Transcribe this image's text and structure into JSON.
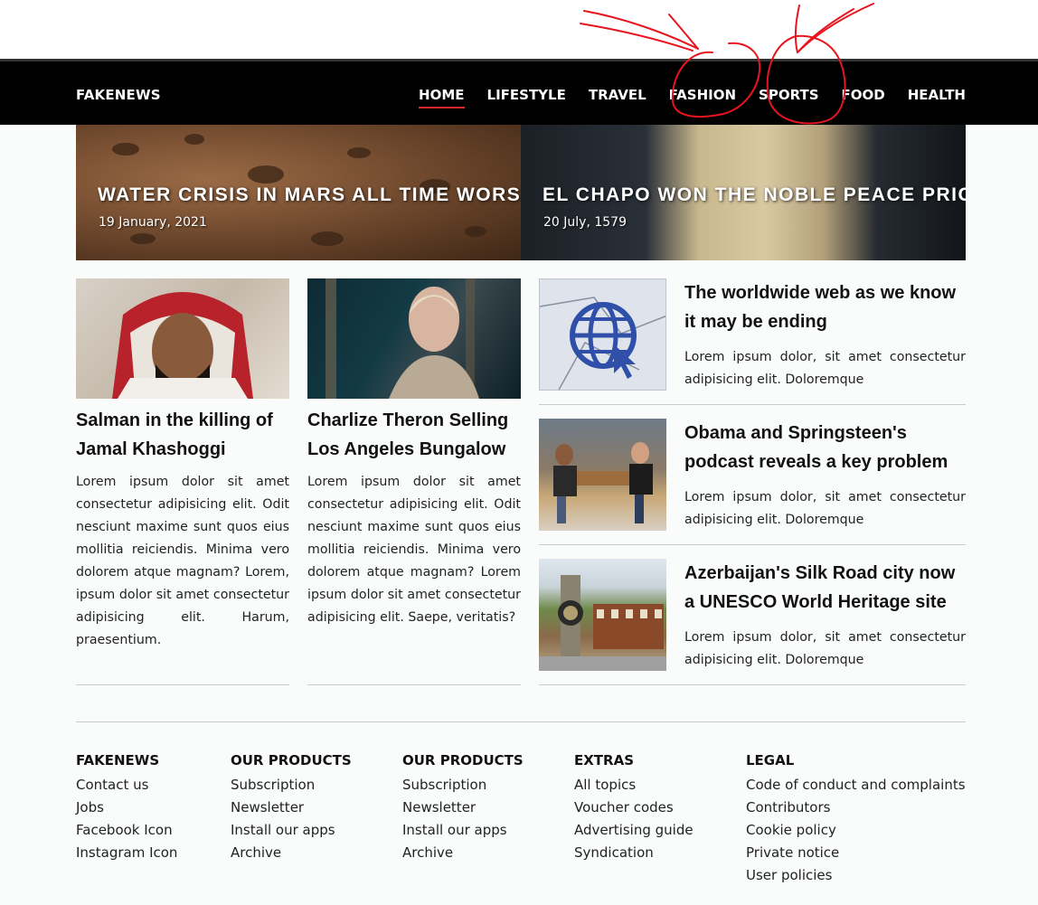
{
  "nav": {
    "brand": "FAKENEWS",
    "items": [
      {
        "label": "HOME",
        "active": true
      },
      {
        "label": "LIFESTYLE"
      },
      {
        "label": "TRAVEL"
      },
      {
        "label": "FASHION"
      },
      {
        "label": "SPORTS"
      },
      {
        "label": "FOOD"
      },
      {
        "label": "HEALTH"
      }
    ],
    "active_color": "#e0262d"
  },
  "annotation_color": "#e8141e",
  "hero": [
    {
      "title": "WATER CRISIS IN MARS ALL TIME WORST",
      "date": "19 January, 2021"
    },
    {
      "title": "EL CHAPO WON THE NOBLE PEACE PRICE",
      "date": "20 July, 1579"
    }
  ],
  "articles": [
    {
      "title": "Salman in the killing of Jamal Khashoggi",
      "body": "Lorem ipsum dolor sit amet consectetur adipisicing elit. Odit nesciunt maxime sunt quos eius mollitia reiciendis. Minima vero dolorem atque magnam? Lorem, ipsum dolor sit amet consectetur adipisicing elit. Harum, praesentium."
    },
    {
      "title": "Charlize Theron Selling Los Angeles Bungalow",
      "body": "Lorem ipsum dolor sit amet consectetur adipisicing elit. Odit nesciunt maxime sunt quos eius mollitia reiciendis. Minima vero dolorem atque magnam? Lorem ipsum dolor sit amet consectetur adipisicing elit. Saepe, veritatis?"
    }
  ],
  "side": [
    {
      "title": "The worldwide web as we know it may be ending",
      "body": "Lorem ipsum dolor, sit amet consectetur adipisicing elit. Doloremque"
    },
    {
      "title": "Obama and Springsteen's podcast reveals a key problem",
      "body": "Lorem ipsum dolor, sit amet consectetur adipisicing elit. Doloremque"
    },
    {
      "title": "Azerbaijan's Silk Road city now a UNESCO World Heritage site",
      "body": "Lorem ipsum dolor, sit amet consectetur adipisicing elit. Doloremque"
    }
  ],
  "footer": [
    {
      "heading": "FAKENEWS",
      "links": [
        "Contact us",
        "Jobs",
        "Facebook Icon",
        "Instagram Icon"
      ]
    },
    {
      "heading": "OUR PRODUCTS",
      "links": [
        "Subscription",
        "Newsletter",
        "Install our apps",
        "Archive"
      ]
    },
    {
      "heading": "OUR PRODUCTS",
      "links": [
        "Subscription",
        "Newsletter",
        "Install our apps",
        "Archive"
      ]
    },
    {
      "heading": "EXTRAS",
      "links": [
        "All topics",
        "Voucher codes",
        "Advertising guide",
        "Syndication"
      ]
    },
    {
      "heading": "LEGAL",
      "links": [
        "Code of conduct and complaints",
        "Contributors",
        "Cookie policy",
        "Private notice",
        "User policies"
      ]
    }
  ]
}
